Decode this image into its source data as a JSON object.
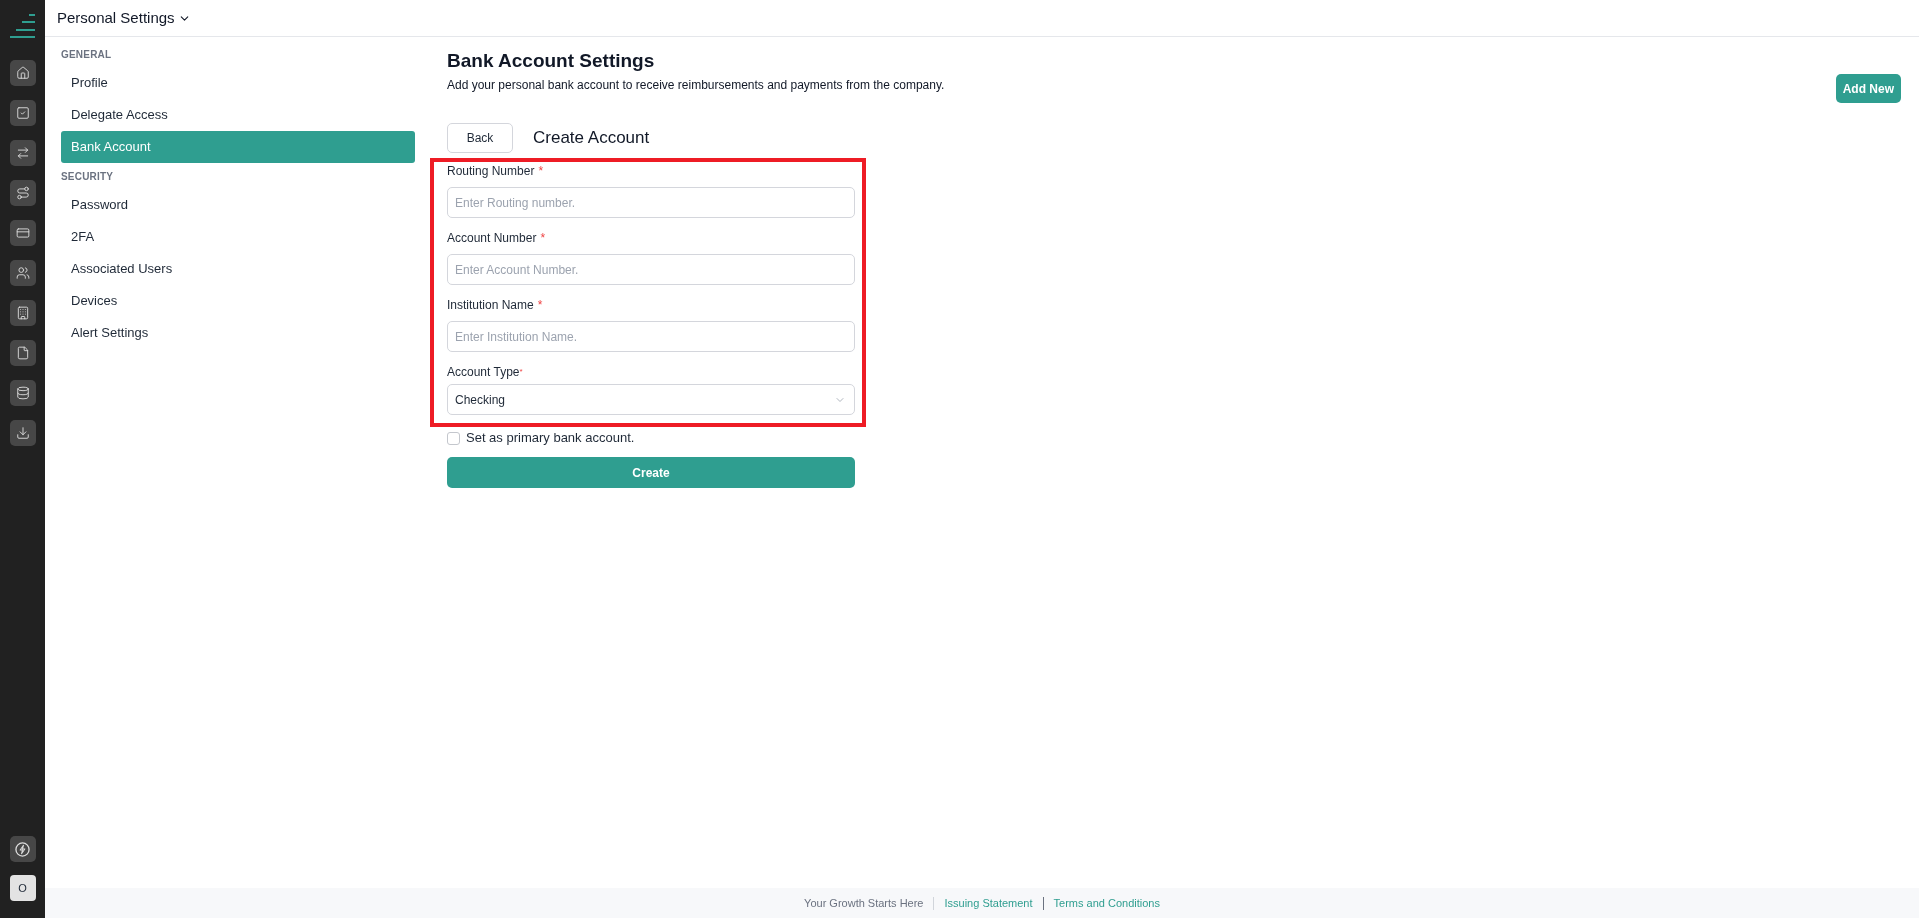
{
  "header": {
    "title": "Personal Settings"
  },
  "avatar": {
    "initial": "O"
  },
  "sidebar": {
    "sections": [
      {
        "heading": "GENERAL",
        "items": [
          {
            "label": "Profile",
            "selected": false
          },
          {
            "label": "Delegate Access",
            "selected": false
          },
          {
            "label": "Bank Account",
            "selected": true
          }
        ]
      },
      {
        "heading": "SECURITY",
        "items": [
          {
            "label": "Password",
            "selected": false
          },
          {
            "label": "2FA",
            "selected": false
          },
          {
            "label": "Associated Users",
            "selected": false
          },
          {
            "label": "Devices",
            "selected": false
          },
          {
            "label": "Alert Settings",
            "selected": false
          }
        ]
      }
    ]
  },
  "page": {
    "title": "Bank Account Settings",
    "subtitle": "Add your personal bank account to receive reimbursements and payments from the company.",
    "add_button": "Add New"
  },
  "form": {
    "back_button": "Back",
    "title": "Create Account",
    "highlighted": true,
    "fields": [
      {
        "kind": "input",
        "label": "Routing Number",
        "required_mark": "*",
        "mark_raised": false,
        "placeholder": "Enter Routing number."
      },
      {
        "kind": "input",
        "label": "Account Number",
        "required_mark": "*",
        "mark_raised": false,
        "placeholder": "Enter Account Number."
      },
      {
        "kind": "input",
        "label": "Institution Name",
        "required_mark": "*",
        "mark_raised": false,
        "placeholder": "Enter Institution Name."
      },
      {
        "kind": "select",
        "label": "Account Type",
        "required_mark": "*",
        "mark_raised": true,
        "value": "Checking"
      }
    ],
    "primary_checkbox": {
      "label": "Set as primary bank account.",
      "checked": false
    },
    "submit_button": "Create"
  },
  "footer": {
    "items": [
      {
        "kind": "text",
        "label": "Your Growth Starts Here"
      },
      {
        "kind": "link",
        "label": "Issuing Statement"
      },
      {
        "kind": "link",
        "label": "Terms and Conditions"
      }
    ]
  }
}
